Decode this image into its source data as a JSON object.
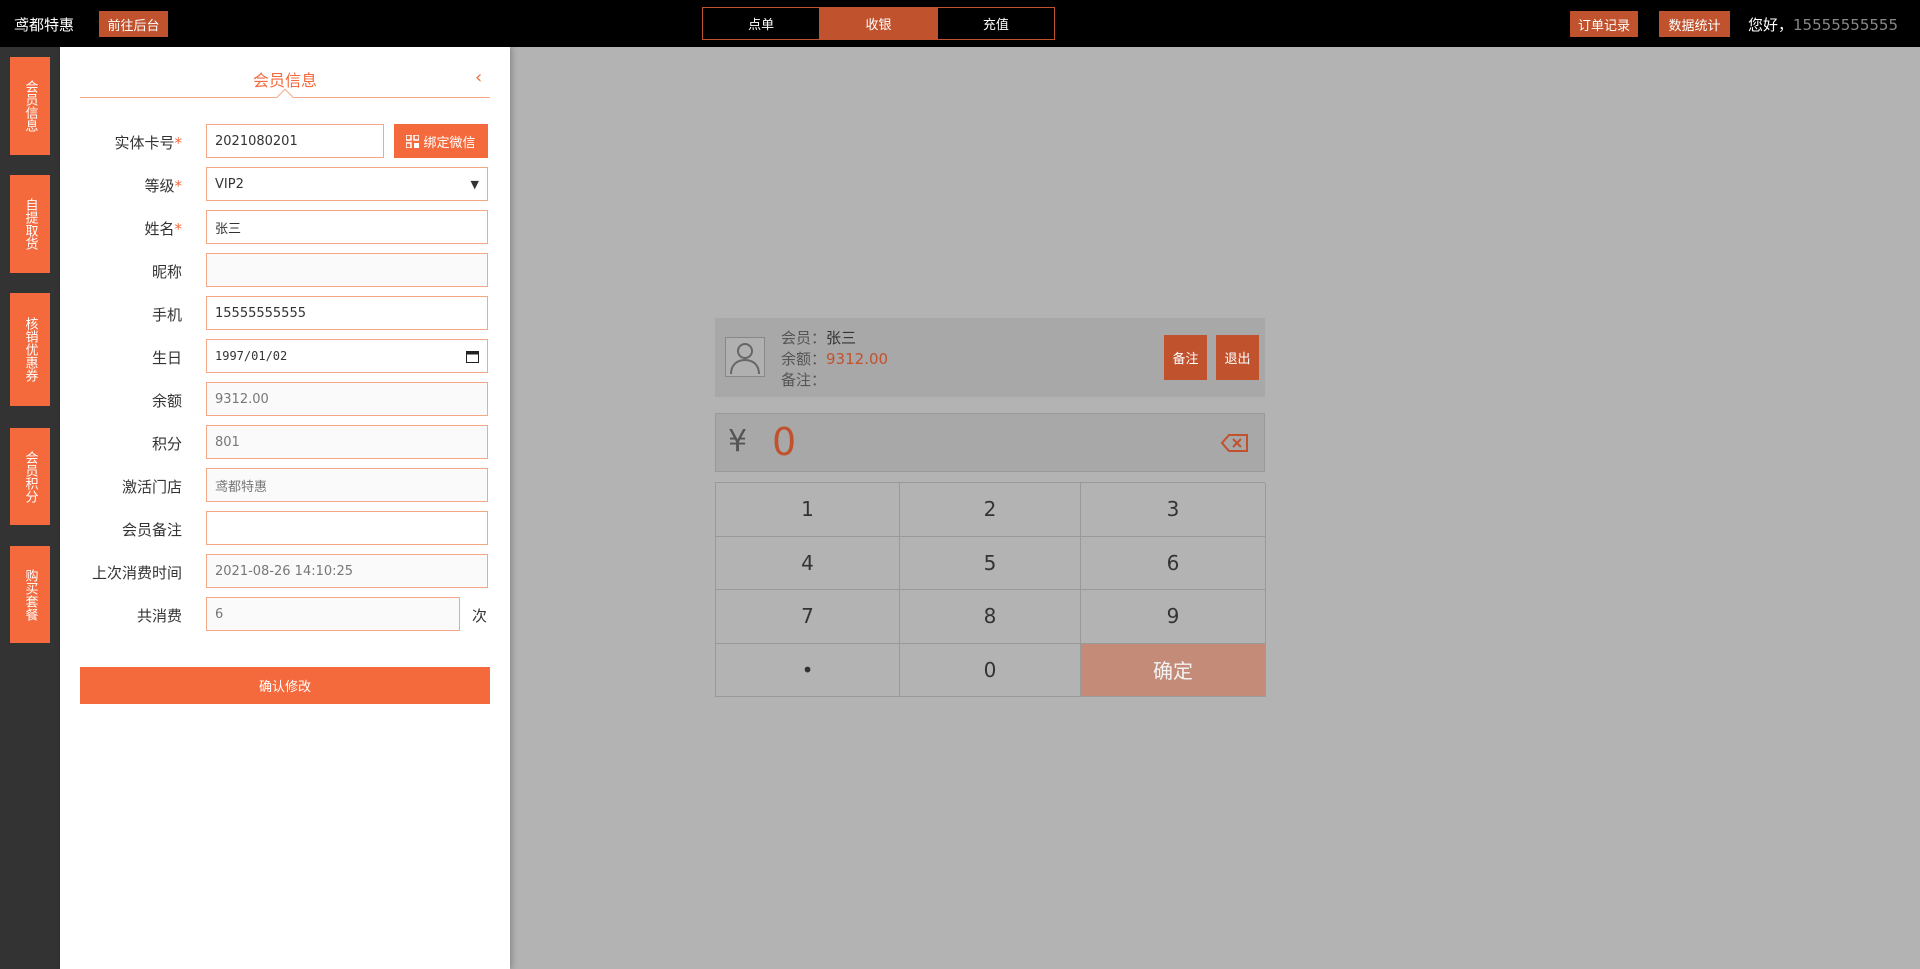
{
  "topbar": {
    "brand": "鸢都特惠",
    "goto_backend": "前往后台",
    "tabs": [
      {
        "label": "点单",
        "active": false
      },
      {
        "label": "收银",
        "active": true
      },
      {
        "label": "充值",
        "active": false
      }
    ],
    "orders": "订单记录",
    "stats": "数据统计",
    "greeting": "您好，",
    "phone": "15555555555"
  },
  "sidebar": {
    "items": [
      "会员信息",
      "自提取货",
      "核销优惠券",
      "会员积分",
      "购买套餐"
    ]
  },
  "panel": {
    "title": "会员信息",
    "fields": {
      "card_label": "实体卡号",
      "card_value": "2021080201",
      "bind_wechat": "绑定微信",
      "level_label": "等级",
      "level_value": "VIP2",
      "name_label": "姓名",
      "name_value": "张三",
      "nick_label": "昵称",
      "nick_value": "",
      "mobile_label": "手机",
      "mobile_value": "15555555555",
      "birthday_label": "生日",
      "birthday_value": "1997/01/02",
      "balance_label": "余额",
      "balance_value": "9312.00",
      "points_label": "积分",
      "points_value": "801",
      "store_label": "激活门店",
      "store_value": "鸢都特惠",
      "remark_label": "会员备注",
      "remark_value": "",
      "last_label": "上次消费时间",
      "last_value": "2021-08-26 14:10:25",
      "count_label": "共消费",
      "count_value": "6",
      "count_unit": "次"
    },
    "confirm": "确认修改"
  },
  "member": {
    "member_label": "会员：",
    "member_name": "张三",
    "balance_label": "余额：",
    "balance": "9312.00",
    "remark_label": "备注：",
    "remark_btn": "备注",
    "exit_btn": "退出"
  },
  "cashier": {
    "currency": "¥",
    "amount": "0",
    "keys": [
      "1",
      "2",
      "3",
      "4",
      "5",
      "6",
      "7",
      "8",
      "9",
      "•",
      "0",
      "确定"
    ]
  },
  "colors": {
    "accent": "#f56a3c",
    "accent_dark": "#c0522e"
  }
}
